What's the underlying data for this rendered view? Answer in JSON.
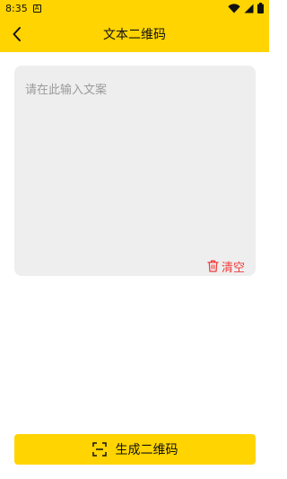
{
  "status_bar": {
    "time": "8:35",
    "notification_icon": "A"
  },
  "app_bar": {
    "title": "文本二维码"
  },
  "input": {
    "placeholder": "请在此输入文案",
    "value": ""
  },
  "clear": {
    "label": "清空"
  },
  "generate_button": {
    "label": "生成二维码"
  },
  "colors": {
    "accent": "#FFD400",
    "danger": "#F23B3B",
    "card_bg": "#EEEEEE"
  }
}
